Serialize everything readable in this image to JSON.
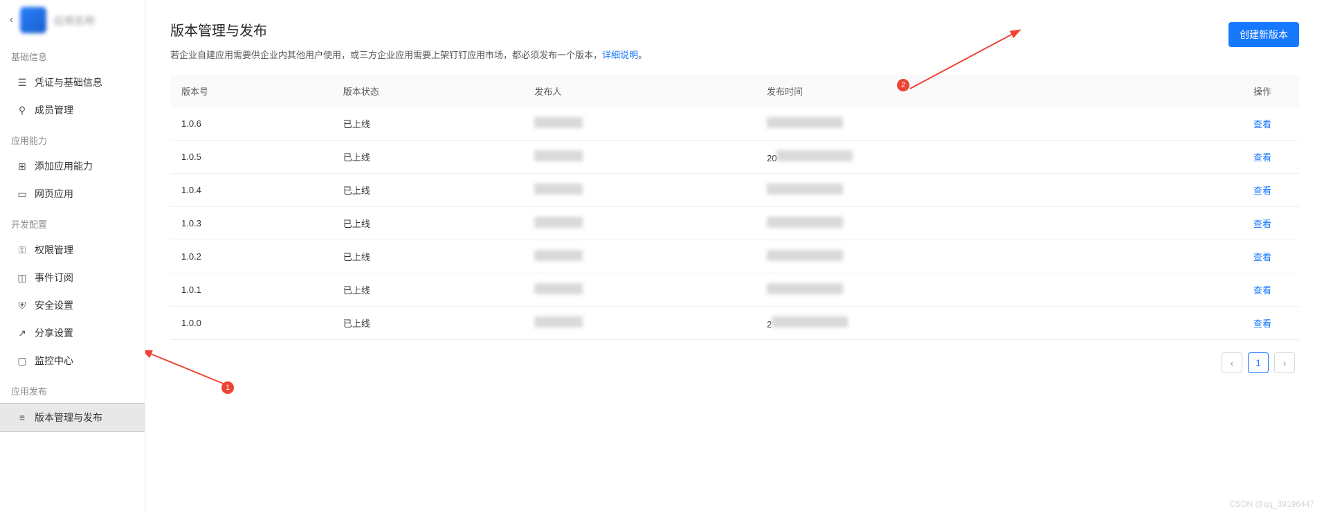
{
  "header": {
    "app_name": "应用名称"
  },
  "sidebar": {
    "sections": [
      {
        "label": "基础信息",
        "items": [
          {
            "icon": "credential-icon",
            "label": "凭证与基础信息"
          },
          {
            "icon": "member-icon",
            "label": "成员管理"
          }
        ]
      },
      {
        "label": "应用能力",
        "items": [
          {
            "icon": "ability-icon",
            "label": "添加应用能力"
          },
          {
            "icon": "webapp-icon",
            "label": "网页应用"
          }
        ]
      },
      {
        "label": "开发配置",
        "items": [
          {
            "icon": "permission-icon",
            "label": "权限管理"
          },
          {
            "icon": "event-icon",
            "label": "事件订阅"
          },
          {
            "icon": "security-icon",
            "label": "安全设置"
          },
          {
            "icon": "share-icon",
            "label": "分享设置"
          },
          {
            "icon": "monitor-icon",
            "label": "监控中心"
          }
        ]
      },
      {
        "label": "应用发布",
        "items": [
          {
            "icon": "version-icon",
            "label": "版本管理与发布",
            "active": true
          }
        ]
      }
    ]
  },
  "main": {
    "title": "版本管理与发布",
    "description_prefix": "若企业自建应用需要供企业内其他用户使用，或三方企业应用需要上架钉钉应用市场，都必须发布一个版本，",
    "description_link": "详细说明",
    "description_suffix": "。",
    "create_button": "创建新版本",
    "table": {
      "headers": [
        "版本号",
        "版本状态",
        "发布人",
        "发布时间",
        "操作"
      ],
      "rows": [
        {
          "version": "1.0.6",
          "status": "已上线",
          "publisher": "",
          "time": "",
          "action": "查看"
        },
        {
          "version": "1.0.5",
          "status": "已上线",
          "publisher": "",
          "time": "20",
          "action": "查看"
        },
        {
          "version": "1.0.4",
          "status": "已上线",
          "publisher": "",
          "time": "",
          "action": "查看"
        },
        {
          "version": "1.0.3",
          "status": "已上线",
          "publisher": "",
          "time": "",
          "action": "查看"
        },
        {
          "version": "1.0.2",
          "status": "已上线",
          "publisher": "",
          "time": "",
          "action": "查看"
        },
        {
          "version": "1.0.1",
          "status": "已上线",
          "publisher": "",
          "time": "",
          "action": "查看"
        },
        {
          "version": "1.0.0",
          "status": "已上线",
          "publisher": "",
          "time": "2",
          "action": "查看"
        }
      ]
    },
    "pagination": {
      "current": "1"
    }
  },
  "annotations": {
    "badge1": "1",
    "badge2": "2"
  },
  "watermark": "CSDN @qq_39196447",
  "icons": {
    "credential-icon": "☰",
    "member-icon": "⚲",
    "ability-icon": "⊞",
    "webapp-icon": "▭",
    "permission-icon": "⚿",
    "event-icon": "◫",
    "security-icon": "⛨",
    "share-icon": "↗",
    "monitor-icon": "▢",
    "version-icon": "≡"
  }
}
